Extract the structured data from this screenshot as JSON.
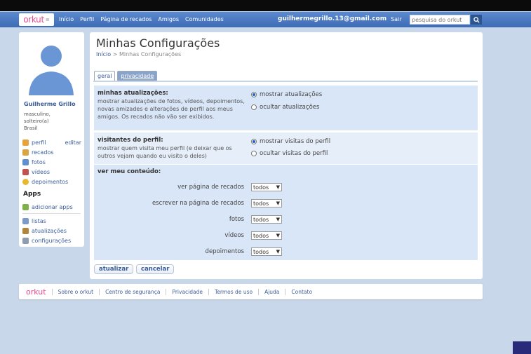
{
  "topbar": {
    "logo": "orkut",
    "nav": [
      "Início",
      "Perfil",
      "Página de recados",
      "Amigos",
      "Comunidades"
    ],
    "email": "guilhermegrillo.13@gmail.com",
    "logout": "Sair",
    "search_placeholder": "pesquisa do orkut"
  },
  "profile": {
    "name": "Guilherme Grillo",
    "info": [
      "masculino,",
      "solteiro(a)",
      "Brasil"
    ],
    "menu": [
      {
        "label": "perfil",
        "icon": "user-icon",
        "extra": "editar"
      },
      {
        "label": "recados",
        "icon": "scrap-icon"
      },
      {
        "label": "fotos",
        "icon": "photo-icon"
      },
      {
        "label": "vídeos",
        "icon": "video-icon"
      },
      {
        "label": "depoimentos",
        "icon": "testimonial-icon"
      }
    ],
    "apps_title": "Apps",
    "apps_add": "adicionar apps",
    "menu2": [
      {
        "label": "listas",
        "icon": "list-icon"
      },
      {
        "label": "atualizações",
        "icon": "updates-icon"
      },
      {
        "label": "configurações",
        "icon": "settings-icon"
      }
    ]
  },
  "main": {
    "title": "Minhas Configurações",
    "breadcrumb_home": "Início",
    "breadcrumb_sep": ">",
    "breadcrumb_current": "Minhas Configurações",
    "tabs": [
      "geral",
      "privacidade"
    ],
    "updates": {
      "title": "minhas atualizações:",
      "desc": "mostrar atualizações de fotos, vídeos, depoimentos, novas amizades e alterações de perfil aos meus amigos. Os recados não vão ser exibidos.",
      "opt1": "mostrar atualizações",
      "opt2": "ocultar atualizações",
      "selected": "mostrar atualizações"
    },
    "visitors": {
      "title": "visitantes do perfil:",
      "desc": "mostrar quem visita meu perfil (e deixar que os outros vejam quando eu visito o deles)",
      "opt1": "mostrar visitas do perfil",
      "opt2": "ocultar visitas do perfil",
      "selected": "mostrar visitas do perfil"
    },
    "content": {
      "title": "ver meu conteúdo:",
      "rows": [
        {
          "label": "ver página de recados",
          "value": "todos"
        },
        {
          "label": "escrever na página de recados",
          "value": "todos"
        },
        {
          "label": "fotos",
          "value": "todos"
        },
        {
          "label": "vídeos",
          "value": "todos"
        },
        {
          "label": "depoimentos",
          "value": "todos"
        }
      ]
    },
    "save": "atualizar",
    "cancel": "cancelar"
  },
  "footer": {
    "logo": "orkut",
    "links": [
      "Sobre o orkut",
      "Centro de segurança",
      "Privacidade",
      "Termos de uso",
      "Ajuda",
      "Contato"
    ]
  }
}
